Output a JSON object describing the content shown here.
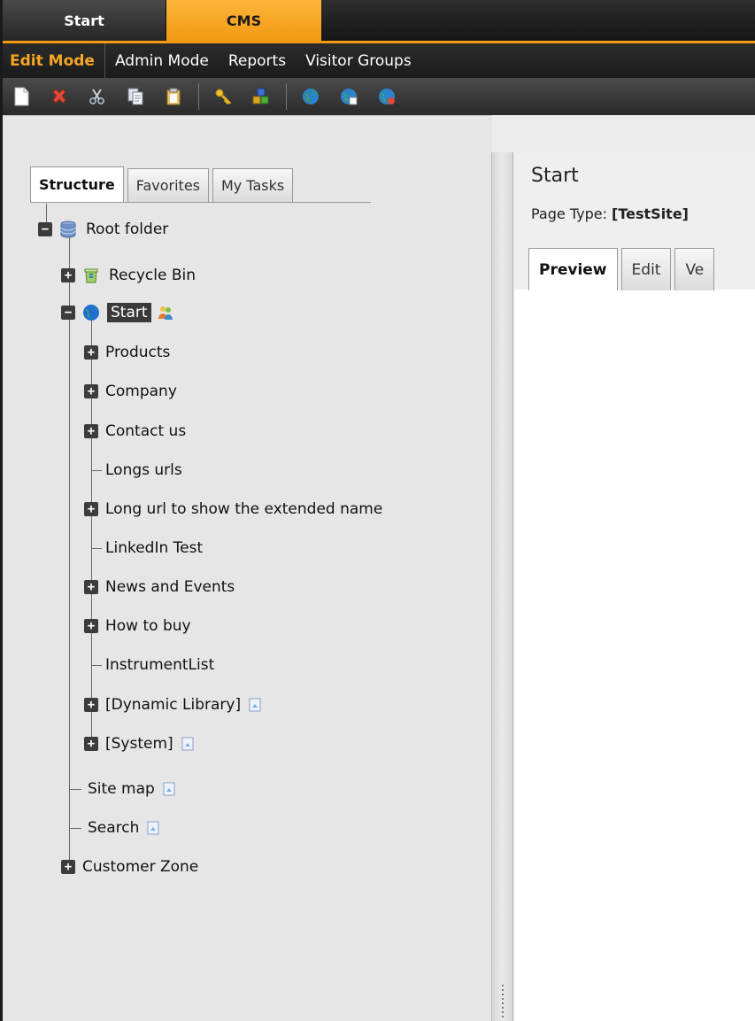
{
  "top_tabs": {
    "start": "Start",
    "cms": "CMS"
  },
  "modes": [
    "Edit Mode",
    "Admin Mode",
    "Reports",
    "Visitor Groups"
  ],
  "left_tabs": [
    "Structure",
    "Favorites",
    "My Tasks"
  ],
  "tree": {
    "root": "Root folder",
    "recycle_bin": "Recycle Bin",
    "start": "Start",
    "children": [
      "Products",
      "Company",
      "Contact us",
      "Longs urls",
      "Long url to show the extended name",
      "LinkedIn Test",
      "News and Events",
      "How to buy",
      "InstrumentList",
      "[Dynamic Library]",
      "[System]"
    ],
    "site_map": "Site map",
    "search": "Search",
    "customer_zone": "Customer Zone"
  },
  "right": {
    "title": "Start",
    "page_type_label": "Page Type: ",
    "page_type_value": "[TestSite]",
    "tabs": [
      "Preview",
      "Edit",
      "Ve"
    ]
  },
  "colors": {
    "accent": "#f39a13",
    "dark": "#1e1e1e"
  }
}
